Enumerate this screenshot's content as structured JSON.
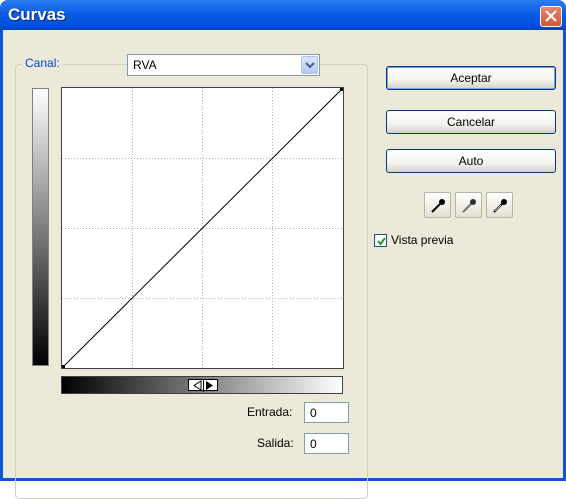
{
  "window": {
    "title": "Curvas"
  },
  "channel": {
    "label": "Canal:",
    "value": "RVA"
  },
  "buttons": {
    "ok": "Aceptar",
    "cancel": "Cancelar",
    "auto": "Auto"
  },
  "fields": {
    "input": {
      "label": "Entrada:",
      "value": "0"
    },
    "output": {
      "label": "Salida:",
      "value": "0"
    }
  },
  "preview": {
    "label": "Vista previa",
    "checked": true
  },
  "eyedroppers": [
    "black-point-eyedropper-icon",
    "gray-point-eyedropper-icon",
    "white-point-eyedropper-icon"
  ],
  "colors": {
    "titlebar": "#0a5ee6",
    "dialog_bg": "#ece9d8",
    "label_blue": "#0046d5",
    "checkmark": "#21a121"
  }
}
